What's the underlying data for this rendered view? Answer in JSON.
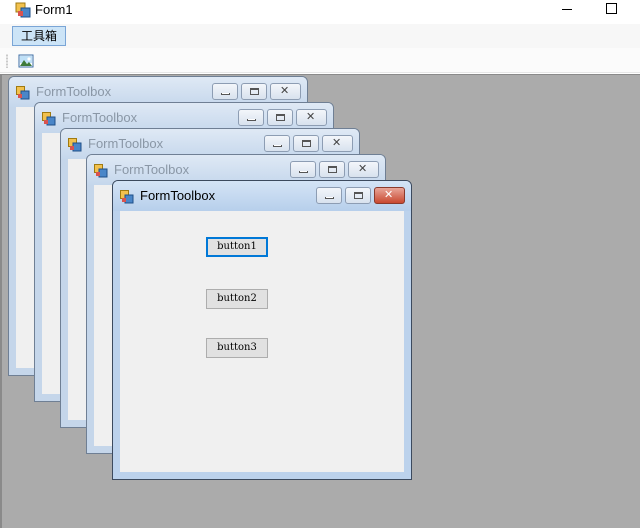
{
  "window": {
    "title": "Form1"
  },
  "menu": {
    "items": [
      {
        "label": "工具箱"
      }
    ]
  },
  "toolbar": {
    "items": [
      {
        "icon": "image-icon"
      }
    ]
  },
  "children": [
    {
      "title": "FormToolbox",
      "active": false
    },
    {
      "title": "FormToolbox",
      "active": false
    },
    {
      "title": "FormToolbox",
      "active": false
    },
    {
      "title": "FormToolbox",
      "active": false
    },
    {
      "title": "FormToolbox",
      "active": true
    }
  ],
  "active_form": {
    "buttons": [
      {
        "label": "button1",
        "focused": true
      },
      {
        "label": "button2",
        "focused": false
      },
      {
        "label": "button3",
        "focused": false
      }
    ]
  },
  "colors": {
    "mdi_background": "#ababab",
    "focus_border": "#0078d7",
    "close_button": "#c9482f"
  }
}
